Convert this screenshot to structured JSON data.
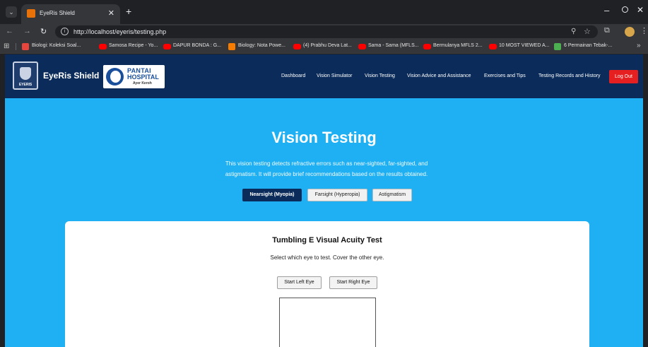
{
  "browser": {
    "tab_title": "EyeRis Shield",
    "tab_close": "✕",
    "new_tab": "+",
    "url": "http://localhost/eyeris/testing.php",
    "bookmarks": [
      {
        "label": "Biologi: Koleksi Soal...",
        "color": "#e8453c"
      },
      {
        "label": "Samosa Recipe - Yo...",
        "color": "#ff0000"
      },
      {
        "label": "DAPUR BONDA : G...",
        "color": "#ff0000"
      },
      {
        "label": "Biology: Nota Powe...",
        "color": "#f57c00"
      },
      {
        "label": "(4) Prabhu Deva Lat...",
        "color": "#ff0000"
      },
      {
        "label": "Sama - Sama (MFLS...",
        "color": "#ff0000"
      },
      {
        "label": "Bermulanya MFLS 2...",
        "color": "#ff0000"
      },
      {
        "label": "10 MOST VIEWED A...",
        "color": "#ff0000"
      },
      {
        "label": "6 Permainan Tebak-...",
        "color": "#4caf50"
      }
    ],
    "bookmarks_more": "»"
  },
  "header": {
    "brand": "EyeRis Shield",
    "shield_text": "EYERIS",
    "hospital": {
      "line1": "PANTAI",
      "line2": "HOSPITAL",
      "line3": "Ayer Keroh"
    },
    "nav": [
      "Dashboard",
      "Vision Simulator",
      "Vision Testing",
      "Vision Advice and Assistance",
      "Exercises and Tips",
      "Testing Records and History"
    ],
    "logout": "Log Out"
  },
  "hero": {
    "title": "Vision Testing",
    "description": "This vision testing detects refractive errors such as near-sighted, far-sighted, and astigmatism. It will provide brief recommendations based on the results obtained.",
    "tests": [
      {
        "label": "Nearsight (Myopia)",
        "active": true
      },
      {
        "label": "Farsight (Hyperopia)",
        "active": false
      },
      {
        "label": "Astigmatism",
        "active": false
      }
    ]
  },
  "card": {
    "title": "Tumbling E Visual Acuity Test",
    "subtitle": "Select which eye to test. Cover the other eye.",
    "left_eye": "Start Left Eye",
    "right_eye": "Start Right Eye"
  },
  "colors": {
    "header_bg": "#0b2c5a",
    "page_bg": "#1fb0f3",
    "logout": "#e62020"
  }
}
